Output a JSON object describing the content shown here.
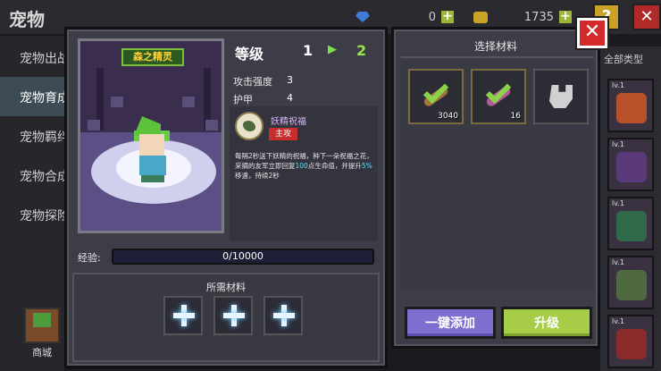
{
  "background": {
    "title": "宠物",
    "gems": "0",
    "coins": "1735",
    "help_label": "?",
    "close_label": "✕",
    "sidebar": [
      {
        "label": "宠物出战",
        "active": false
      },
      {
        "label": "宠物育成",
        "active": true
      },
      {
        "label": "宠物羁绊",
        "active": false
      },
      {
        "label": "宠物合成",
        "active": false
      },
      {
        "label": "宠物探险",
        "active": false
      }
    ],
    "shop_label": "商城",
    "bottom_badge": "主攻",
    "type_label": "全部类型",
    "pet_cards": [
      "lv.1",
      "lv.1",
      "lv.1",
      "lv.1",
      "lv.1"
    ]
  },
  "pet": {
    "name": "森之精灵",
    "level_label": "等级",
    "level_from": "1",
    "level_arrow": "▶",
    "level_to": "2",
    "stats": [
      {
        "label": "攻击强度",
        "value": "3"
      },
      {
        "label": "护甲",
        "value": "4"
      }
    ],
    "skill": {
      "name": "妖精祝福",
      "tag": "主攻",
      "desc_pre": "每隔2秒送下妖精的祝福，种下一朵祝福之花，采摘的友军立即回复",
      "desc_hl1": "100",
      "desc_mid": "点生命值，并提升",
      "desc_hl2": "5%",
      "desc_post": "移速，持续2秒"
    },
    "exp_label": "经验:",
    "exp_text": "0/10000",
    "exp_fraction": 0.0
  },
  "required": {
    "title": "所需材料",
    "slots": [
      "add",
      "add",
      "add"
    ]
  },
  "select": {
    "title": "选择材料",
    "materials": [
      {
        "icon": "bone-check-icon",
        "count": "3040",
        "color": "#a0743a"
      },
      {
        "icon": "bone-check-icon",
        "count": "16",
        "color": "#b05a9a"
      },
      {
        "icon": "stone-icon",
        "count": "",
        "color": "#cfd0d2"
      }
    ],
    "add_all_label": "一键添加",
    "upgrade_label": "升级"
  },
  "dialog_close_label": "✕"
}
